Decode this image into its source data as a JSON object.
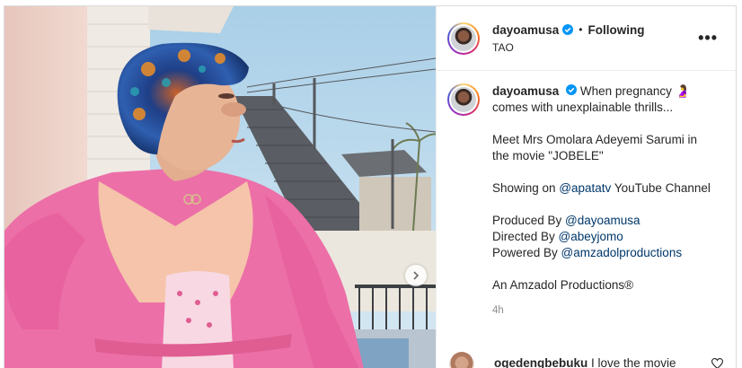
{
  "post": {
    "username": "dayoamusa",
    "following_label": "Following",
    "dot": "•",
    "location": "TAO",
    "more": "•••"
  },
  "caption": {
    "username": "dayoamusa",
    "line1": "When pregnancy 🤰 comes with unexplainable thrills...",
    "line2": "Meet Mrs Omolara Adeyemi Sarumi in the movie \"JOBELE\"",
    "line3_prefix": "Showing on ",
    "line3_mention": "@apatatv",
    "line3_suffix": " YouTube Channel",
    "produced_prefix": "Produced By ",
    "produced_mention": "@dayoamusa",
    "directed_prefix": "Directed By ",
    "directed_mention": "@abeyjomo",
    "powered_prefix": "Powered By ",
    "powered_mention": "@amzadolproductions",
    "footer": "An Amzadol Productions®",
    "time": "4h"
  },
  "comment": {
    "username": "ogedengbebuku",
    "text": "I love the movie"
  },
  "icons": {
    "verified": "verified-badge-icon",
    "next": "chevron-right-icon",
    "like": "heart-icon"
  },
  "colors": {
    "accent_blue": "#0095f6",
    "link_blue": "#00376b",
    "robe_pink": "#ec6fa8"
  }
}
